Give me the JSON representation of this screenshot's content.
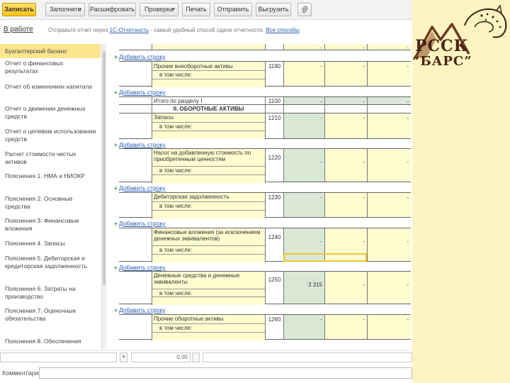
{
  "toolbar": {
    "write": "Записать",
    "fill": "Заполнить",
    "decode": "Расшифровать",
    "check": "Проверка",
    "print": "Печать",
    "send": "Отправить",
    "upload": "Выгрузить"
  },
  "status": {
    "in_work": "В работе",
    "info_prefix": "Отправьте отчет через ",
    "info_link": "1С-Отчетность",
    "info_mid": " - самый удобный способ сдачи отчетности. ",
    "info_link2": "Все способы"
  },
  "sidebar": {
    "items": [
      {
        "label": "Бухгалтерский баланс",
        "active": true
      },
      {
        "label": "Отчет о финансовых результатах"
      },
      {
        "label": "Отчет об изменениях капитала"
      },
      {
        "label": "Отчет о движении денежных средств"
      },
      {
        "label": "Отчет о целевом использовании средств"
      },
      {
        "label": "Расчет стоимости чистых активов"
      },
      {
        "label": "Пояснения 1. НМА и НИОКР"
      },
      {
        "label": "Пояснения 2. Основные средства"
      },
      {
        "label": "Пояснения 3. Финансовые вложения"
      },
      {
        "label": "Пояснения 4. Запасы"
      },
      {
        "label": "Пояснения 5. Дебиторская и кредиторская задолженность"
      },
      {
        "label": "Пояснения 6. Затраты на производство"
      },
      {
        "label": "Пояснения 7. Оценочные обязательства"
      },
      {
        "label": "Пояснения 8. Обеспечения"
      }
    ]
  },
  "form": {
    "add_row": "Добавить строку",
    "incl": "в том числе:",
    "dash": "-",
    "r1190": {
      "name": "Прочие внеоборотные активы",
      "code": "1190"
    },
    "r1100": {
      "name": "Итого по разделу I",
      "code": "1100"
    },
    "section2": "II. ОБОРОТНЫЕ АКТИВЫ",
    "r1210": {
      "name": "Запасы",
      "code": "1210"
    },
    "r1220": {
      "name": "Налог на добавленную стоимость по приобретенным ценностям",
      "code": "1220"
    },
    "r1230": {
      "name": "Дебиторская задолженность",
      "code": "1230"
    },
    "r1240": {
      "name": "Финансовые вложения (за исключением денежных эквивалентов)",
      "code": "1240"
    },
    "r1250": {
      "name": "Денежные средства и денежные эквиваленты",
      "code": "1250",
      "value": "3 315"
    },
    "r1260": {
      "name": "Прочие оборотные активы",
      "code": "1260"
    }
  },
  "bottom": {
    "amount": "0.00",
    "comment_label": "Комментарий:"
  },
  "logo": {
    "line1": "РССК",
    "line2": "“БАРС”"
  },
  "colors": {
    "accent": "#f6c21a",
    "row_yellow": "#fffcd0",
    "row_green": "#d9e8d5",
    "link": "#2a5db0",
    "logo_bg": "#fdf4c2",
    "logo_brown": "#4a2412"
  }
}
